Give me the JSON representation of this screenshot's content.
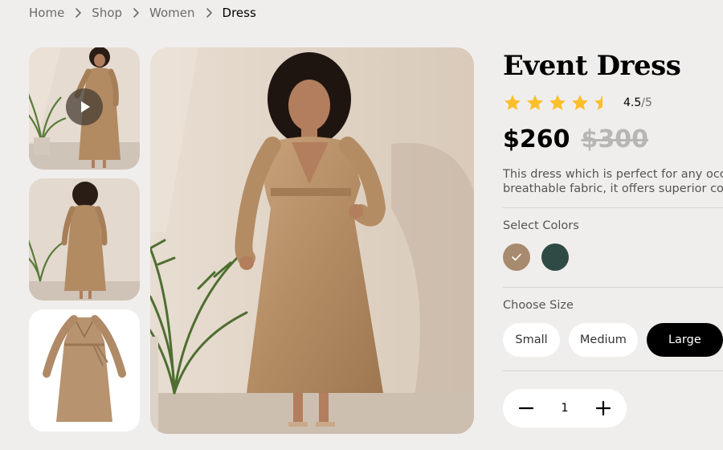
{
  "breadcrumb": {
    "items": [
      "Home",
      "Shop",
      "Women",
      "Dress"
    ]
  },
  "gallery": {
    "thumbnails": [
      {
        "kind": "video",
        "icon": "play-icon"
      },
      {
        "kind": "image"
      },
      {
        "kind": "image"
      }
    ]
  },
  "product": {
    "title": "Event Dress",
    "rating": {
      "value": "4.5",
      "max": "/5",
      "stars": 4.5
    },
    "price": {
      "current": "$260",
      "original": "$300"
    },
    "description": {
      "line1": "This dress which is perfect for any occasion. Crafted from a soft and",
      "line2": "breathable fabric, it offers superior comfort and style."
    },
    "colors": {
      "label": "Select Colors",
      "options": [
        {
          "hex": "#a88a6e",
          "selected": true
        },
        {
          "hex": "#2f4a44",
          "selected": false
        }
      ]
    },
    "sizes": {
      "label": "Choose Size",
      "options": [
        "Small",
        "Medium",
        "Large"
      ],
      "selected": "Large"
    },
    "quantity": {
      "value": "1"
    }
  },
  "colors": {
    "background": "#f0eeed",
    "star": "#fcbf2a",
    "text": "#000000",
    "muted": "#6b6b6b"
  }
}
